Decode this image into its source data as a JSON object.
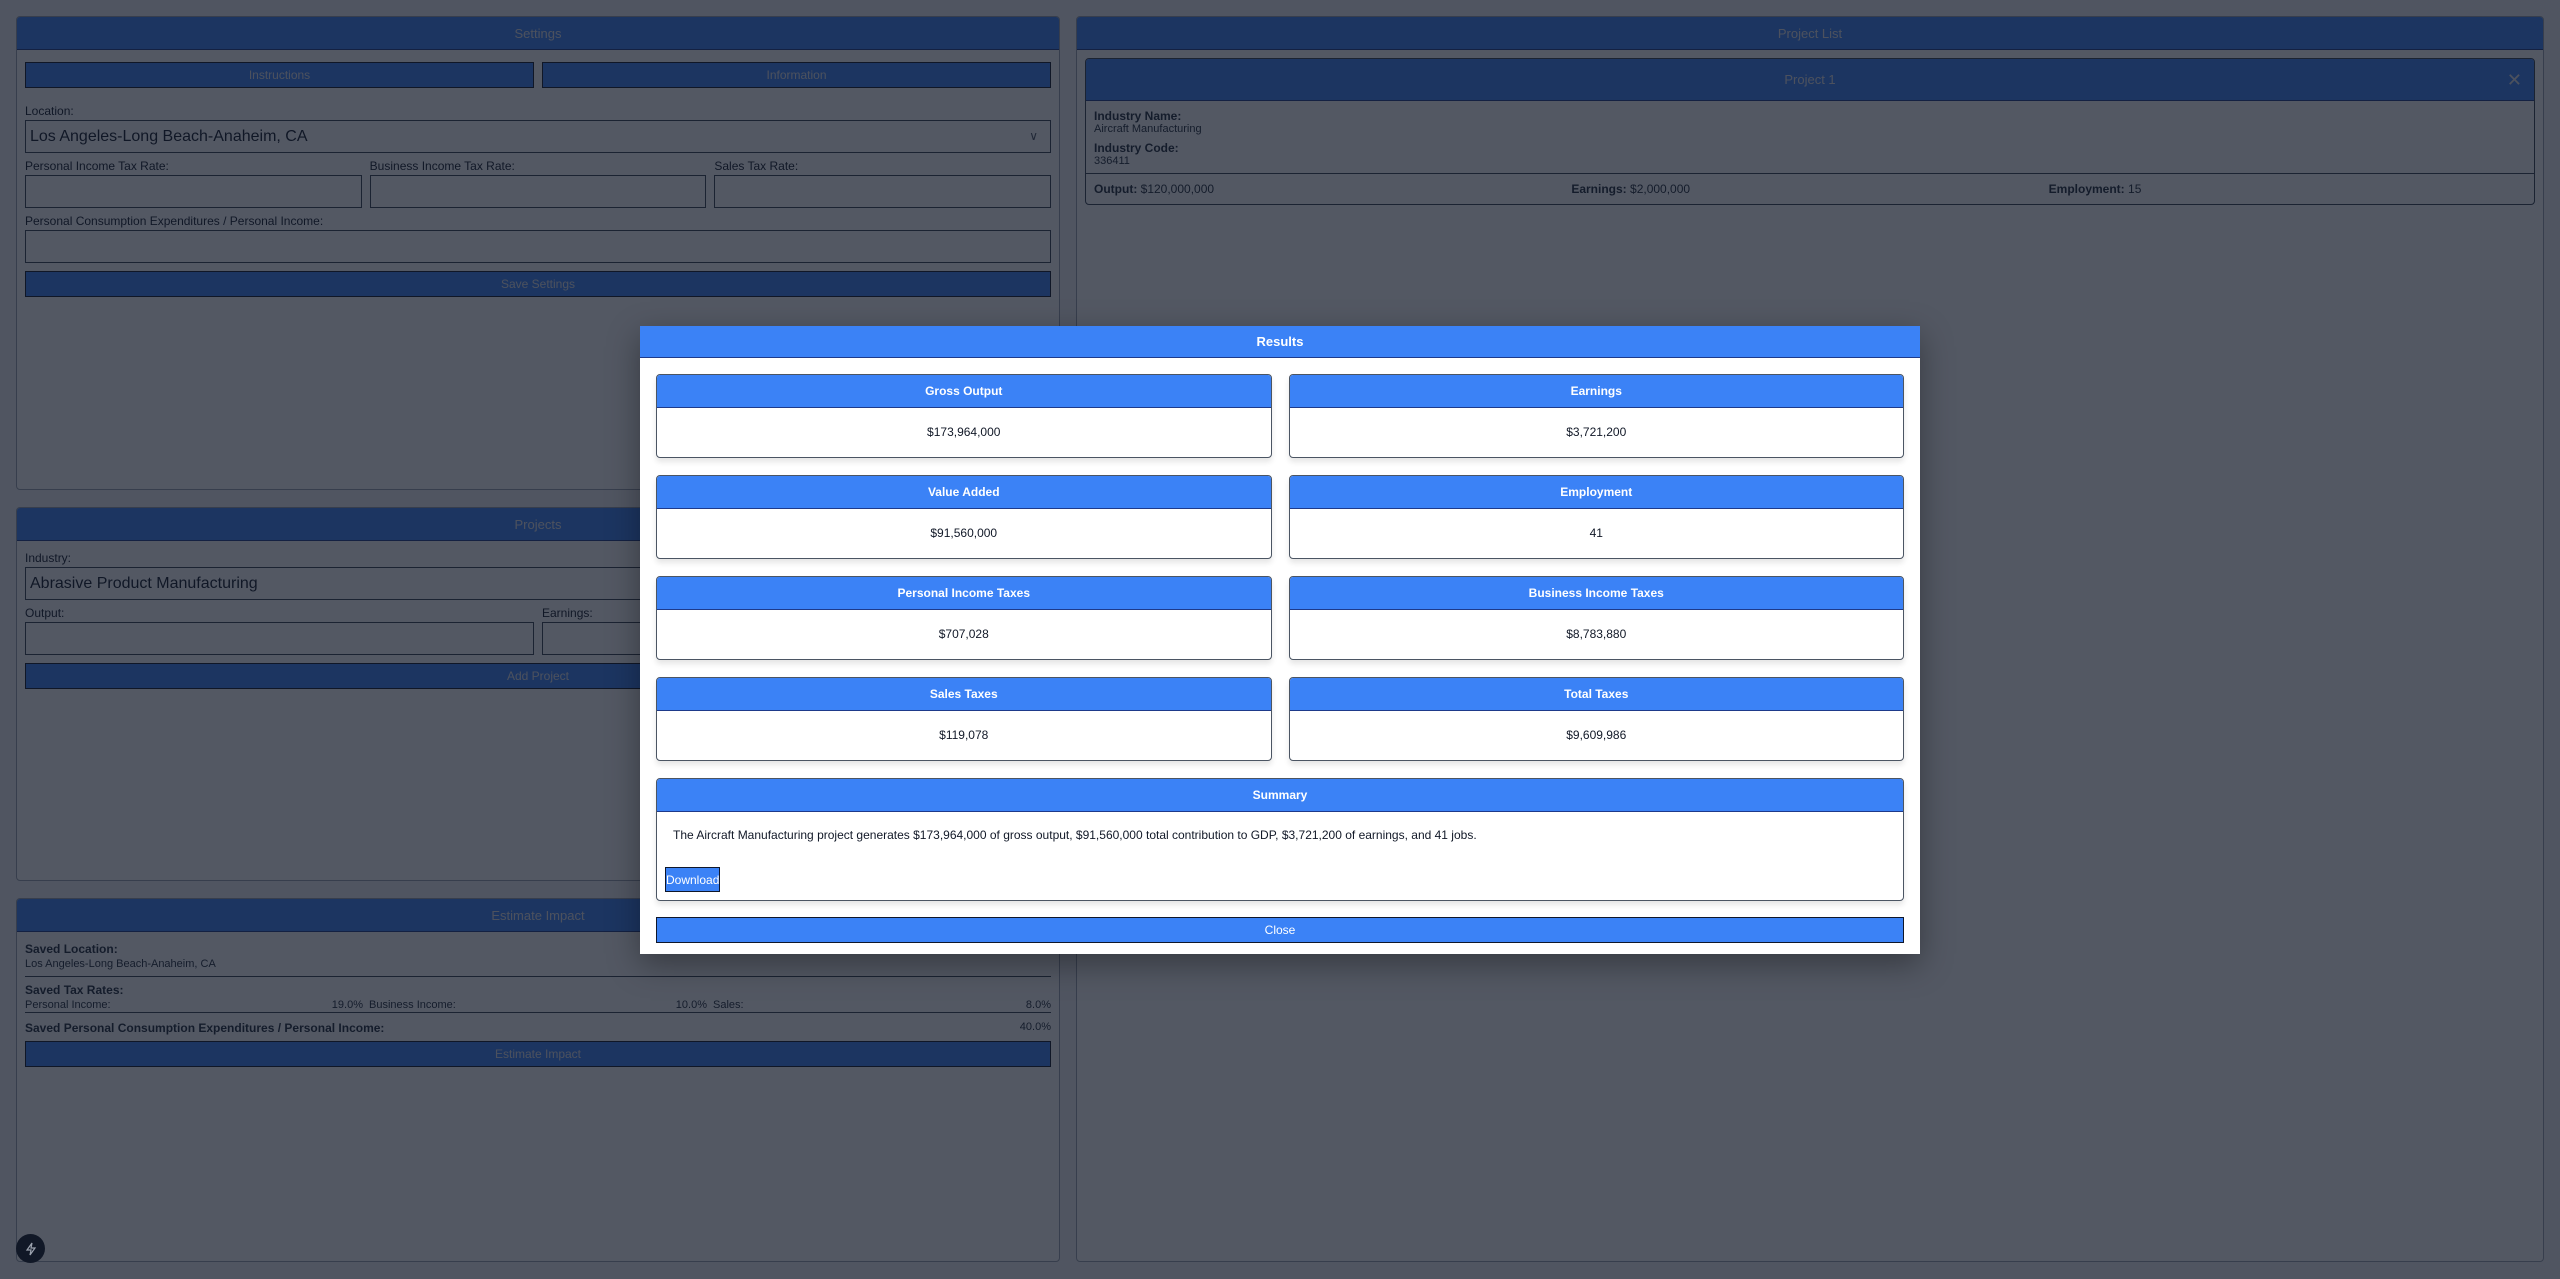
{
  "colors": {
    "accent": "#3b82f6",
    "overlay": "#111827",
    "text": "#111827"
  },
  "settings": {
    "title": "Settings",
    "instructions_label": "Instructions",
    "information_label": "Information",
    "location_label": "Location:",
    "location_value": "Los Angeles-Long Beach-Anaheim, CA",
    "personal_income_tax_label": "Personal Income Tax Rate:",
    "personal_income_tax_value": "",
    "business_income_tax_label": "Business Income Tax Rate:",
    "business_income_tax_value": "",
    "sales_tax_label": "Sales Tax Rate:",
    "sales_tax_value": "",
    "pce_label": "Personal Consumption Expenditures / Personal Income:",
    "pce_value": "",
    "save_label": "Save Settings"
  },
  "projects": {
    "title": "Projects",
    "industry_label": "Industry:",
    "industry_value": "Abrasive Product Manufacturing",
    "output_label": "Output:",
    "output_value": "",
    "earnings_label": "Earnings:",
    "earnings_value": "",
    "add_label": "Add Project"
  },
  "estimate": {
    "title": "Estimate Impact",
    "saved_location_label": "Saved Location:",
    "saved_location_value": "Los Angeles-Long Beach-Anaheim, CA",
    "saved_rates_label": "Saved Tax Rates:",
    "rates": [
      {
        "label": "Personal Income:",
        "value": "19.0%"
      },
      {
        "label": "Business Income:",
        "value": "10.0%"
      },
      {
        "label": "Sales:",
        "value": "8.0%"
      }
    ],
    "saved_pce_label": "Saved Personal Consumption Expenditures / Personal Income:",
    "saved_pce_value": "40.0%",
    "button_label": "Estimate Impact"
  },
  "project_list": {
    "title": "Project List",
    "items": [
      {
        "title": "Project 1",
        "close_glyph": "✕",
        "industry_name_label": "Industry Name:",
        "industry_name": "Aircraft Manufacturing",
        "industry_code_label": "Industry Code:",
        "industry_code": "336411",
        "output_label": "Output:",
        "output": "$120,000,000",
        "earnings_label": "Earnings:",
        "earnings": "$2,000,000",
        "employment_label": "Employment:",
        "employment": "15"
      }
    ]
  },
  "results_modal": {
    "title": "Results",
    "cards": [
      {
        "label": "Gross Output",
        "value": "$173,964,000"
      },
      {
        "label": "Earnings",
        "value": "$3,721,200"
      },
      {
        "label": "Value Added",
        "value": "$91,560,000"
      },
      {
        "label": "Employment",
        "value": "41"
      },
      {
        "label": "Personal Income Taxes",
        "value": "$707,028"
      },
      {
        "label": "Business Income Taxes",
        "value": "$8,783,880"
      },
      {
        "label": "Sales Taxes",
        "value": "$119,078"
      },
      {
        "label": "Total Taxes",
        "value": "$9,609,986"
      }
    ],
    "summary_title": "Summary",
    "summary_text": "The Aircraft Manufacturing project generates $173,964,000 of gross output, $91,560,000 total contribution to GDP, $3,721,200 of earnings, and 41 jobs.",
    "download_label": "Download",
    "close_label": "Close"
  },
  "fab": {
    "icon": "lightning-icon"
  }
}
